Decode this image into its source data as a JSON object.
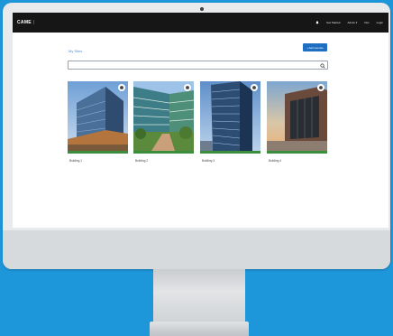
{
  "navbar": {
    "logo": "CAME",
    "logo_suffix": "|",
    "links": [
      "Get Started",
      "Admin ▾",
      "Doc",
      "Login"
    ]
  },
  "page": {
    "title": "My Sites",
    "new_button": "+ Add new site",
    "search_placeholder": ""
  },
  "cards": [
    {
      "label": "Building 1"
    },
    {
      "label": "Building 2"
    },
    {
      "label": "Building 3"
    },
    {
      "label": "Building 4"
    }
  ],
  "colors": {
    "background": "#1d96da",
    "navbar": "#161616",
    "accent": "#1e6fc2",
    "card_bar": "#3c8e3f"
  }
}
